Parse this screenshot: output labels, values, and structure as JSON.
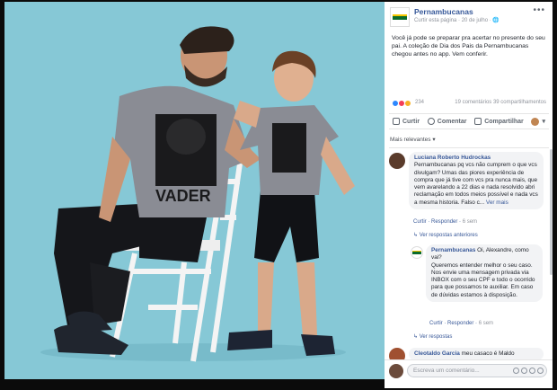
{
  "post": {
    "page_name": "Pernambucanas",
    "meta": "Curtir esta página · 20 de julho · ",
    "text": "Você já pode se preparar pra acertar no presente do seu pai. A coleção de Dia dos Pais da Pernambucanas chegou antes no app. Vem conferir.",
    "reaction_count": "234",
    "stats": "19 comentários  39 compartilhamentos"
  },
  "actions": {
    "like": "Curtir",
    "comment": "Comentar",
    "share": "Compartilhar"
  },
  "filter": {
    "label": "Mais relevantes ▾"
  },
  "comments": [
    {
      "author": "Luciana Roberto Hudrockas",
      "text": "Pernambucanas pq vcs não cumprem o que vcs divulgam? Umas das piores experiência de compra que já tive com vcs pra nunca mais, que vem avarelando a 22 dias e nada resolvido abri reclamação em todos meios possível e nada vcs a mesma historia. Falso c...",
      "more": "Ver mais",
      "like": "Curtir",
      "reply": "Responder",
      "time": "6 sem",
      "replies": "Ver respostas anteriores"
    },
    {
      "author": "Pernambucanas",
      "greeting": "Oi, Alexandre, como vai?",
      "text": "Queremos entender melhor o seu caso. Nos envie uma mensagem privada via INBOX com o seu CPF e todo o ocorrido para que possamos te auxiliar. Em caso de dúvidas estamos à disposição.",
      "like": "Curtir",
      "reply": "Responder",
      "time": "6 sem",
      "replies": "Ver respostas"
    },
    {
      "author": "Cleotaldo Garcia",
      "text": "meu casaco é Maldo"
    }
  ],
  "composer": {
    "placeholder": "Escreva um comentário..."
  },
  "photo": {
    "shirt_text": "VADER"
  },
  "colors": {
    "link": "#365899",
    "photo_bg": "#86c8d6",
    "brand_green": "#0a6b2b",
    "brand_yellow": "#f7c600"
  }
}
